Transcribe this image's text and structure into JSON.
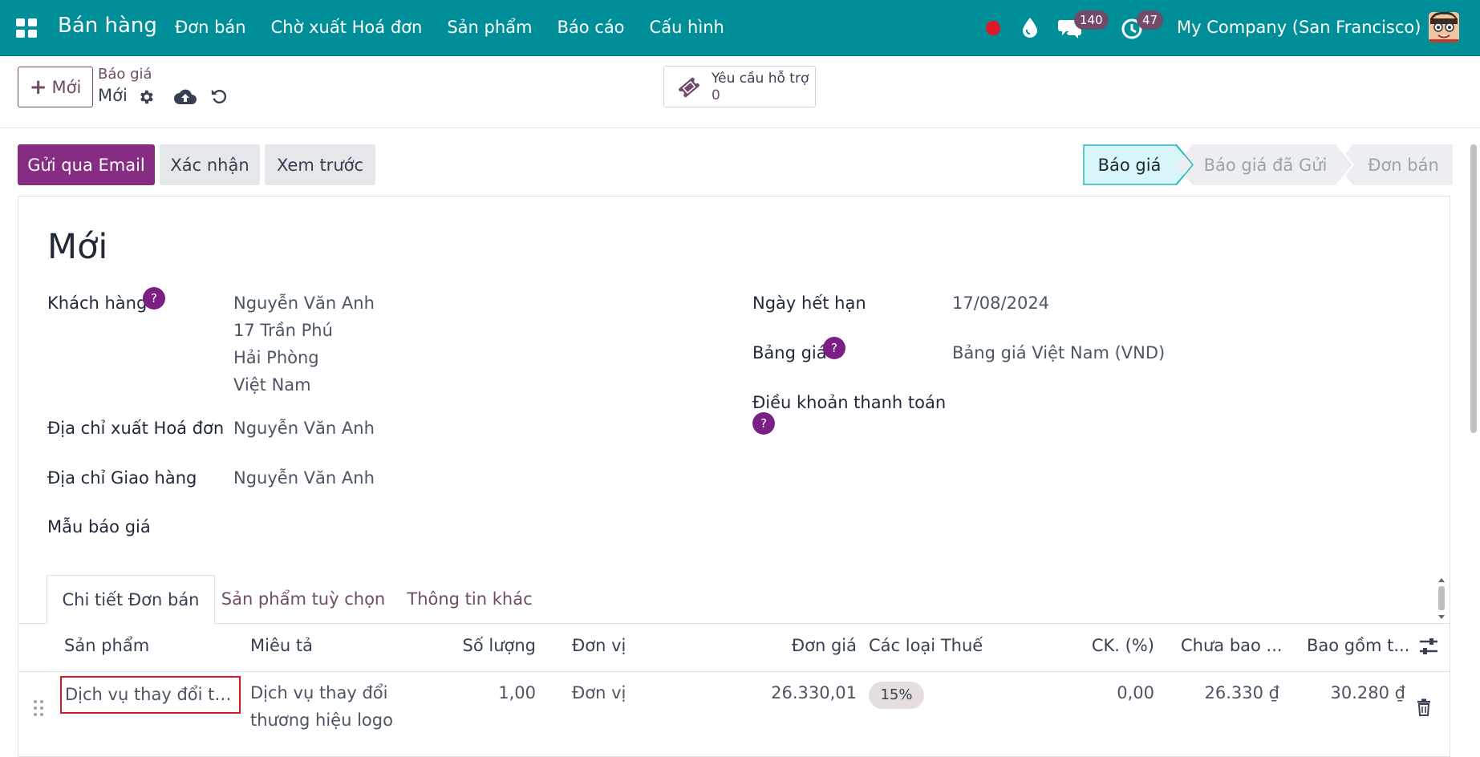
{
  "nav": {
    "app_name": "Bán hàng",
    "menu": [
      "Đơn bán",
      "Chờ xuất Hoá đơn",
      "Sản phẩm",
      "Báo cáo",
      "Cấu hình"
    ],
    "messages_count": "140",
    "activities_count": "47",
    "company": "My Company (San Francisco)"
  },
  "control_panel": {
    "new_label": "Mới",
    "breadcrumb_parent": "Báo giá",
    "breadcrumb_current": "Mới",
    "support_label": "Yêu cầu hỗ trợ",
    "support_count": "0"
  },
  "actions": {
    "send_email": "Gửi qua Email",
    "confirm": "Xác nhận",
    "preview": "Xem trước"
  },
  "status": {
    "stages": [
      "Báo giá",
      "Báo giá đã Gửi",
      "Đơn bán"
    ],
    "active": "Báo giá"
  },
  "form": {
    "title": "Mới",
    "customer_label": "Khách hàng",
    "customer_lines": [
      "Nguyễn Văn Anh",
      "17 Trần Phú",
      "Hải Phòng",
      "Việt Nam"
    ],
    "invoice_address_label": "Địa chỉ xuất Hoá đơn",
    "invoice_address": "Nguyễn Văn Anh",
    "delivery_address_label": "Địa chỉ Giao hàng",
    "delivery_address": "Nguyễn Văn Anh",
    "template_label": "Mẫu báo giá",
    "template_value": "",
    "expiry_label": "Ngày hết hạn",
    "expiry_value": "17/08/2024",
    "pricelist_label": "Bảng giá",
    "pricelist_value": "Bảng giá Việt Nam (VND)",
    "payment_terms_label": "Điều khoản thanh toán",
    "payment_terms_value": "",
    "help_mark": "?"
  },
  "tabs": [
    "Chi tiết Đơn bán",
    "Sản phẩm tuỳ chọn",
    "Thông tin khác"
  ],
  "table": {
    "columns": [
      "Sản phẩm",
      "Miêu tả",
      "Số lượng",
      "Đơn vị",
      "Đơn giá",
      "Các loại Thuế",
      "CK. (%)",
      "Chưa bao ...",
      "Bao gồm t..."
    ],
    "rows": [
      {
        "product": "Dịch vụ thay đổi thương hiệu logo",
        "description_lines": [
          "Dịch vụ thay đổi",
          "thương hiệu logo"
        ],
        "quantity": "1,00",
        "uom": "Đơn vị",
        "unit_price": "26.330,01",
        "tax": "15%",
        "discount": "0,00",
        "subtotal": "26.330 ₫",
        "total": "30.280 ₫"
      }
    ]
  },
  "colors": {
    "nav_bg": "#008f99",
    "primary": "#872c83",
    "link": "#714b67",
    "stage_active_bg": "#d8f5f8",
    "highlight_border": "#d71920"
  }
}
